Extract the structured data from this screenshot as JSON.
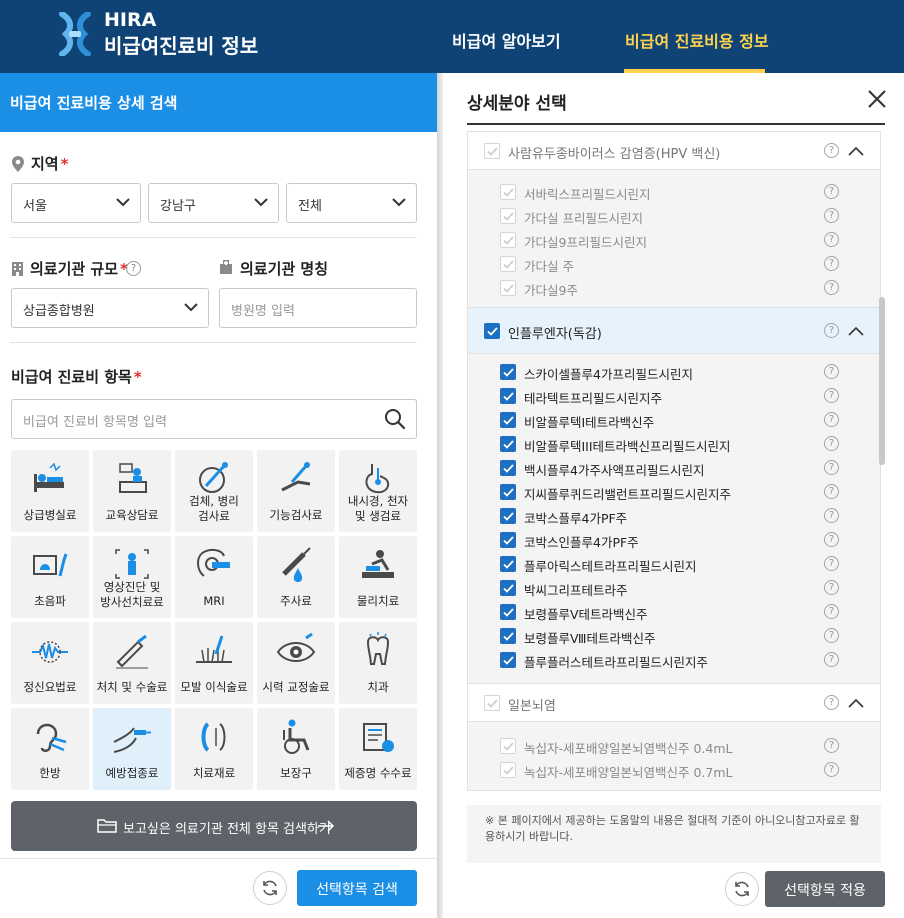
{
  "header": {
    "logo_top": "HIRA",
    "logo_sub": "비급여진료비 정보",
    "nav": [
      "비급여 알아보기",
      "비급여 진료비용 정보"
    ]
  },
  "left": {
    "title": "비급여 진료비용 상세 검색",
    "region_label": "지역",
    "region_selects": [
      "서울",
      "강남구",
      "전체"
    ],
    "scale_label": "의료기관 규모",
    "scale_value": "상급종합병원",
    "name_label": "의료기관 명칭",
    "name_placeholder": "병원명 입력",
    "item_label": "비급여 진료비 항목",
    "item_placeholder": "비급여 진료비 항목명 입력",
    "required_mark": "*",
    "help_mark": "?",
    "categories": [
      {
        "label": "상급병실료",
        "icon": "hospital-bed-icon"
      },
      {
        "label": "교육상담료",
        "icon": "consultation-icon"
      },
      {
        "label": "검체, 병리\n검사료",
        "icon": "specimen-icon"
      },
      {
        "label": "기능검사료",
        "icon": "function-test-icon"
      },
      {
        "label": "내시경, 천자\n및 생검료",
        "icon": "endoscope-icon"
      },
      {
        "label": "초음파",
        "icon": "ultrasound-icon"
      },
      {
        "label": "영상진단 및\n방사선치료료",
        "icon": "radiology-icon"
      },
      {
        "label": "MRI",
        "icon": "mri-icon"
      },
      {
        "label": "주사료",
        "icon": "syringe-icon"
      },
      {
        "label": "물리치료",
        "icon": "physical-therapy-icon"
      },
      {
        "label": "정신요법료",
        "icon": "brainwave-icon"
      },
      {
        "label": "처치 및 수술료",
        "icon": "surgery-icon"
      },
      {
        "label": "모발 이식술료",
        "icon": "hair-transplant-icon"
      },
      {
        "label": "시력 교정술료",
        "icon": "eye-icon"
      },
      {
        "label": "치과",
        "icon": "tooth-icon"
      },
      {
        "label": "한방",
        "icon": "acupuncture-icon"
      },
      {
        "label": "예방접종료",
        "icon": "vaccine-icon"
      },
      {
        "label": "치료재료",
        "icon": "medical-material-icon"
      },
      {
        "label": "보장구",
        "icon": "wheelchair-icon"
      },
      {
        "label": "제증명 수수료",
        "icon": "certificate-icon"
      }
    ],
    "all_search_button": "보고싶은 의료기관 전체 항목 검색하기",
    "search_button": "선택항목 검색"
  },
  "right": {
    "title": "상세분야 선택",
    "groups": [
      {
        "label": "사람유두종바이러스 감염증(HPV 백신)",
        "checked": false,
        "items": [
          "서바릭스프리필드시린지",
          "가다실 프리필드시린지",
          "가다실9프리필드시린지",
          "가다실 주",
          "가다실9주"
        ]
      },
      {
        "label": "인플루엔자(독감)",
        "checked": true,
        "items": [
          "스카이셀플루4가프리필드시린지",
          "테라텍트프리필드시린지주",
          "비알플루텍I테트라백신주",
          "비알플루텍III테트라백신프리필드시린지",
          "백시플루4가주사액프리필드시린지",
          "지씨플루퀴드리밸런트프리필드시린지주",
          "코박스플루4가PF주",
          "코박스인플루4가PF주",
          "플루아릭스테트라프리필드시린지",
          "박씨그리프테트라주",
          "보령플루Ⅴ테트라백신주",
          "보령플루Ⅷ테트라백신주",
          "플루플러스테트라프리필드시린지주"
        ]
      },
      {
        "label": "일본뇌염",
        "checked": false,
        "items": [
          "녹십자-세포배양일본뇌염백신주 0.4mL",
          "녹십자-세포배양일본뇌염백신주 0.7mL"
        ]
      }
    ],
    "notice": "※ 본 페이지에서 제공하는 도움말의 내용은 절대적 기준이 아니오니참고자료로 활용하시기 바랍니다.",
    "apply_button": "선택항목 적용"
  },
  "colors": {
    "header_bg": "#0f4376",
    "accent_blue": "#1b8ee6",
    "nav_active": "#ffd34d",
    "checkbox_blue": "#1c6fc1",
    "dark_button": "#5e6269"
  }
}
